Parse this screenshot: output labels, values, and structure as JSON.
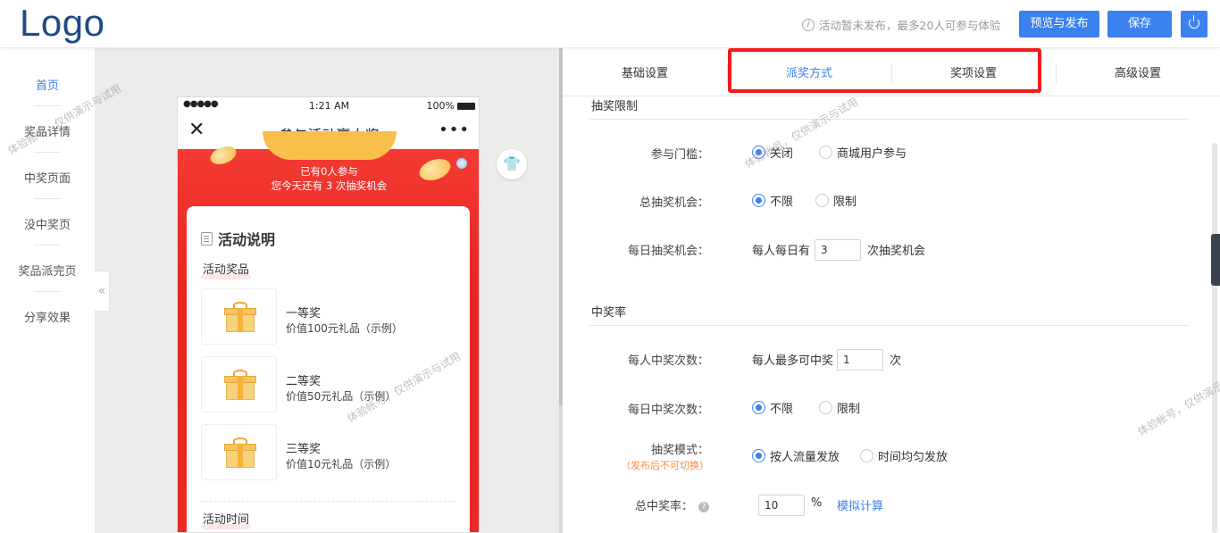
{
  "header": {
    "logo": "Logo",
    "info_icon": "i",
    "notice": "活动暂未发布，最多20人可参与体验",
    "preview_publish": "预览与发布",
    "save": "保存",
    "power_icon": "power-icon"
  },
  "leftnav": {
    "items": [
      {
        "label": "首页",
        "active": true
      },
      {
        "label": "奖品详情",
        "active": false
      },
      {
        "label": "中奖页面",
        "active": false
      },
      {
        "label": "没中奖页",
        "active": false
      },
      {
        "label": "奖品派完页",
        "active": false
      },
      {
        "label": "分享效果",
        "active": false
      }
    ],
    "collapse_glyph": "«"
  },
  "phone": {
    "status": {
      "signal": "●●●●●",
      "time": "1:21 AM",
      "battery": "100%"
    },
    "nav": {
      "close": "✕",
      "title": "参与活动赢大奖",
      "more": "•••"
    },
    "banner": {
      "participants": "已有0人参与",
      "chances": "您今天还有 3 次抽奖机会"
    },
    "card": {
      "title": "活动说明",
      "prizes_label": "活动奖品",
      "prizes": [
        {
          "name": "一等奖",
          "desc": "价值100元礼品（示例）"
        },
        {
          "name": "二等奖",
          "desc": "价值50元礼品（示例）"
        },
        {
          "name": "三等奖",
          "desc": "价值10元礼品（示例）"
        }
      ],
      "time_label": "活动时间"
    }
  },
  "tabs": [
    {
      "label": "基础设置",
      "active": false
    },
    {
      "label": "派奖方式",
      "active": true
    },
    {
      "label": "奖项设置",
      "active": false
    },
    {
      "label": "高级设置",
      "active": false
    }
  ],
  "form": {
    "section1": "抽奖限制",
    "threshold": {
      "label": "参与门槛：",
      "options": [
        "关闭",
        "商城用户参与"
      ],
      "selected": 0
    },
    "total_chances": {
      "label": "总抽奖机会：",
      "options": [
        "不限",
        "限制"
      ],
      "selected": 0
    },
    "daily_chances": {
      "label": "每日抽奖机会：",
      "prefix": "每人每日有",
      "value": "3",
      "suffix": "次抽奖机会"
    },
    "section2": "中奖率",
    "win_count": {
      "label": "每人中奖次数：",
      "prefix": "每人最多可中奖",
      "value": "1",
      "suffix": "次"
    },
    "daily_win": {
      "label": "每日中奖次数：",
      "options": [
        "不限",
        "限制"
      ],
      "selected": 0
    },
    "mode": {
      "label": "抽奖模式：",
      "note": "（发布后不可切换）",
      "options": [
        "按人流量发放",
        "时间均匀发放"
      ],
      "selected": 0
    },
    "rate": {
      "label": "总中奖率：",
      "help": "?",
      "value": "10",
      "unit": "%",
      "link": "模拟计算"
    }
  },
  "watermark": "体验帐号，仅供演示与试用",
  "colors": {
    "accent": "#3b82f0",
    "banner": "#e7241e",
    "highlight_box": "#f21c1c",
    "note": "#ff8a3c"
  }
}
